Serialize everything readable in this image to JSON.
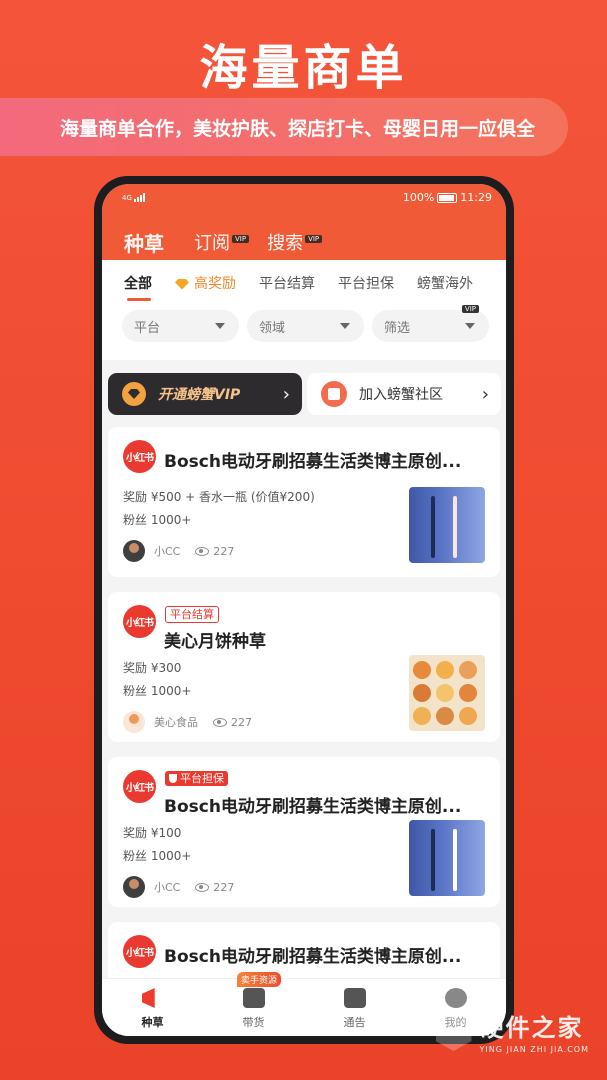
{
  "headline": "海量商单",
  "banner": "海量商单合作，美妆护肤、探店打卡、母婴日用一应俱全",
  "status": {
    "signal": "4G",
    "battery": "100%",
    "time": "11:29"
  },
  "top_nav": {
    "active": "种草",
    "subscribe": "订阅",
    "search": "搜索",
    "vip": "VIP"
  },
  "sub_tabs": [
    "全部",
    "高奖励",
    "平台结算",
    "平台担保",
    "螃蟹海外"
  ],
  "filters": [
    "平台",
    "领域",
    "筛选"
  ],
  "filter_vip": "VIP",
  "cta": {
    "vip": "开通螃蟹VIP",
    "community": "加入螃蟹社区",
    "arrow": "›"
  },
  "cards": [
    {
      "platform": "小红书",
      "title": "Bosch电动牙刷招募生活类博主原创...",
      "tag": "",
      "reward": "奖励 ¥500 + 香水一瓶 (价值¥200)",
      "fans": "粉丝 1000+",
      "author": "小CC",
      "views": "227"
    },
    {
      "platform": "小红书",
      "title": "美心月饼种草",
      "tag": "平台结算",
      "reward": "奖励 ¥300",
      "fans": "粉丝 1000+",
      "author": "美心食品",
      "views": "227"
    },
    {
      "platform": "小红书",
      "title": "Bosch电动牙刷招募生活类博主原创...",
      "tag": "平台担保",
      "reward": "奖励 ¥100",
      "fans": "粉丝 1000+",
      "author": "小CC",
      "views": "227"
    },
    {
      "platform": "小红书",
      "title": "Bosch电动牙刷招募生活类博主原创..."
    }
  ],
  "tab_bar": {
    "items": [
      "种草",
      "带货",
      "通告",
      "我的"
    ],
    "badge": "卖手资源"
  },
  "watermark": {
    "cn": "硬件之家",
    "en": "YING JIAN ZHI JIA.COM"
  },
  "colors": {
    "brand": "#f15a36",
    "accent_red": "#ea3a2f",
    "vip_dark": "#2d2b2e",
    "vip_gold": "#f5c48c"
  }
}
